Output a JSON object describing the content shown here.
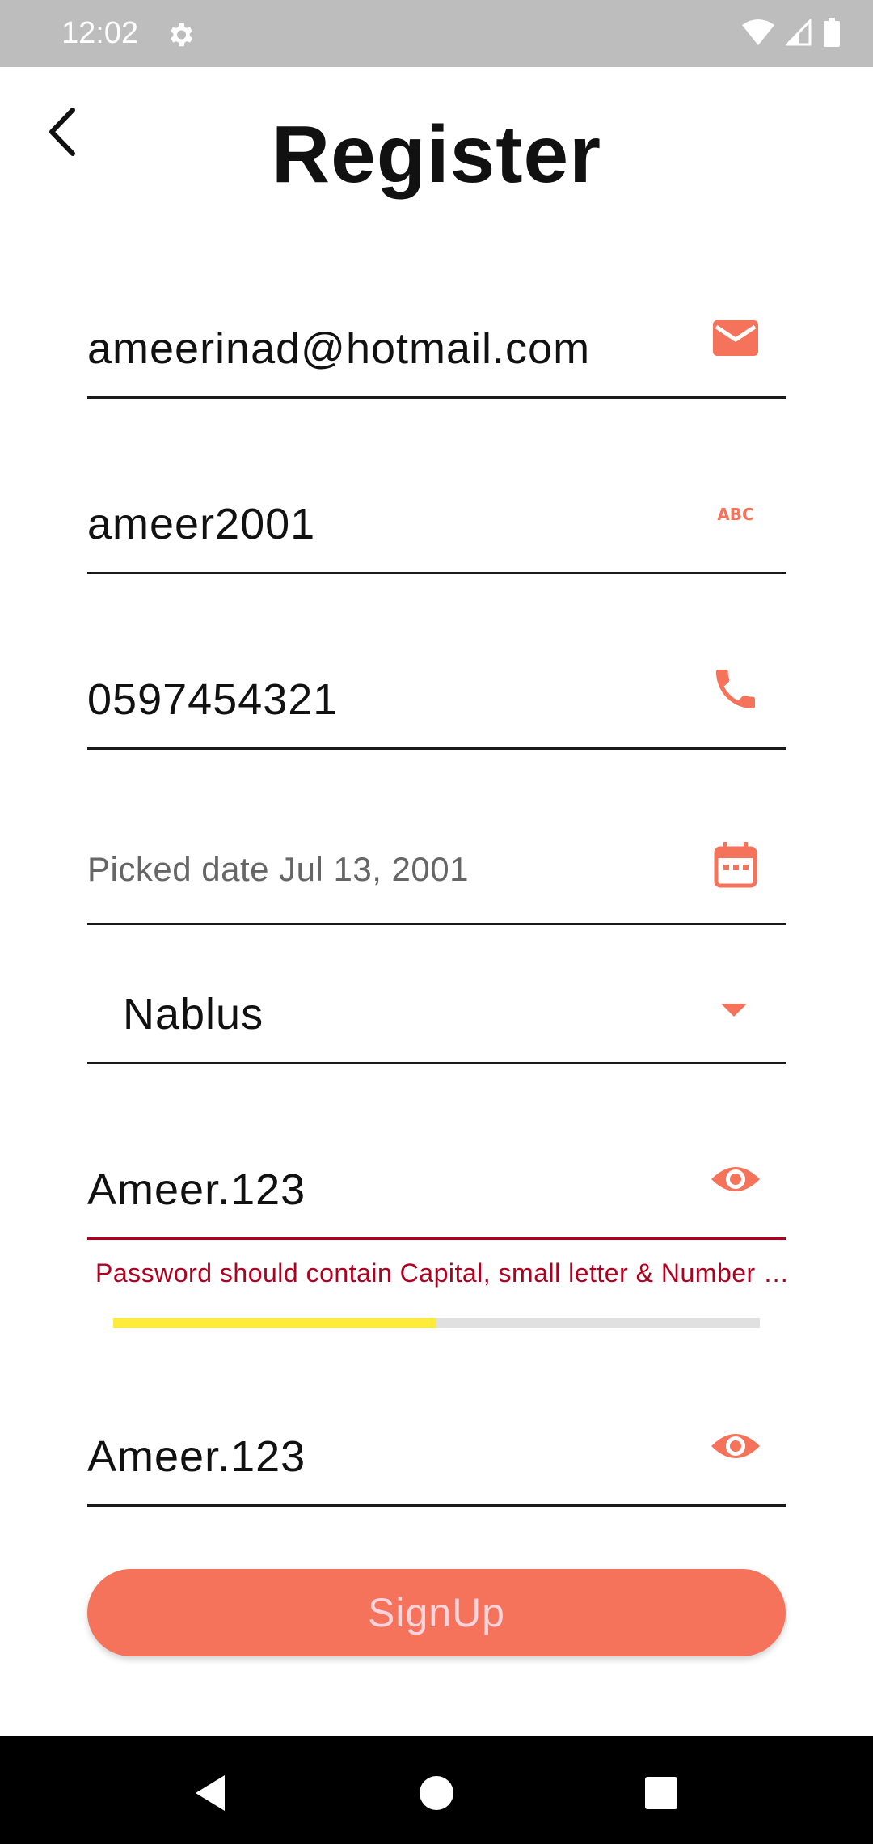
{
  "status_bar": {
    "time": "12:02"
  },
  "header": {
    "title": "Register"
  },
  "form": {
    "email": {
      "value": "ameerinad@hotmail.com"
    },
    "username": {
      "value": "ameer2001"
    },
    "phone": {
      "value": "0597454321"
    },
    "birthdate": {
      "value": "Picked date Jul 13, 2001"
    },
    "city": {
      "selected": "Nablus"
    },
    "password": {
      "value": "Ameer.123",
      "error": "Password should contain Capital, small letter & Number & Special",
      "strength": 0.5
    },
    "confirm_password": {
      "value": "Ameer.123"
    },
    "signup_label": "SignUp"
  },
  "colors": {
    "accent": "#f4735a",
    "error": "#b00020",
    "strength": "#ffeb3b",
    "status_bar": "#bdbdbd"
  },
  "icons": [
    "gear-icon",
    "wifi-icon",
    "signal-icon",
    "battery-icon",
    "back-arrow-icon",
    "email-icon",
    "abc-icon",
    "phone-icon",
    "calendar-icon",
    "dropdown-arrow-icon",
    "eye-icon",
    "nav-back-icon",
    "nav-home-icon",
    "nav-recents-icon"
  ]
}
